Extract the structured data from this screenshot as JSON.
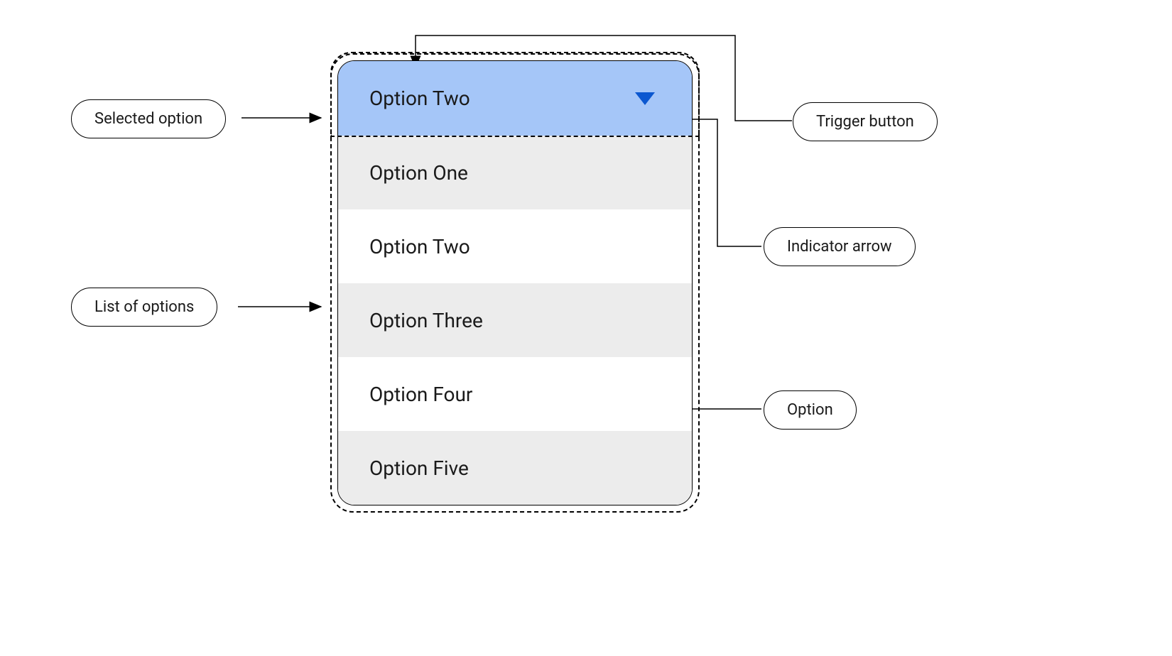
{
  "dropdown": {
    "selected_label": "Option Two",
    "options": [
      "Option One",
      "Option Two",
      "Option Three",
      "Option  Four",
      "Option Five"
    ]
  },
  "annotations": {
    "selected_option": "Selected option",
    "list_of_options": "List of options",
    "trigger_button": "Trigger button",
    "indicator_arrow": "Indicator arrow",
    "option": "Option"
  },
  "colors": {
    "trigger_bg": "#a5c6f8",
    "arrow_fill": "#0b57d0",
    "alt_row_bg": "#ececec"
  }
}
